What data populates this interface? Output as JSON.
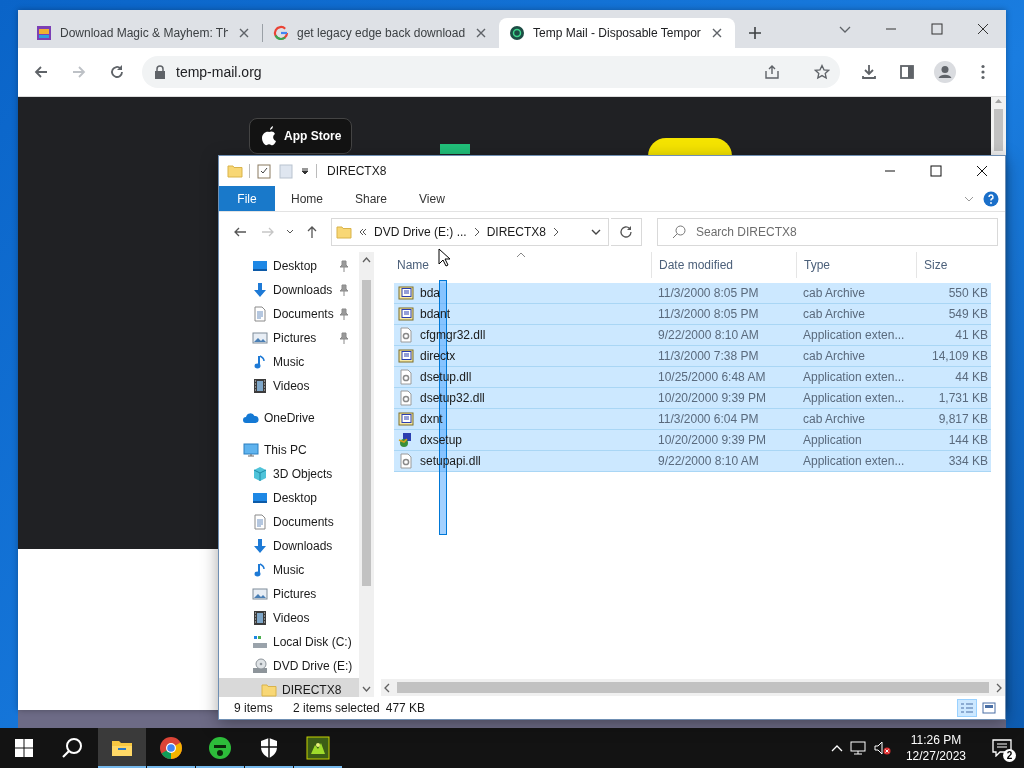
{
  "browser": {
    "tabs": [
      {
        "title": "Download Magic & Mayhem: Th",
        "kind": "game",
        "selected": false
      },
      {
        "title": "get legacy edge back download",
        "kind": "google",
        "selected": false
      },
      {
        "title": "Temp Mail - Disposable Tempor",
        "kind": "tempmail",
        "selected": true
      }
    ],
    "forward_disabled": true,
    "address": "temp-mail.org",
    "page": {
      "app_store_button": "App Store"
    }
  },
  "explorer": {
    "title": "DIRECTX8",
    "ribbon_tabs": [
      {
        "label": "File",
        "selected": true
      },
      {
        "label": "Home",
        "selected": false
      },
      {
        "label": "Share",
        "selected": false
      },
      {
        "label": "View",
        "selected": false
      }
    ],
    "forward_disabled": true,
    "breadcrumb": [
      "DVD Drive (E:) ...",
      "DIRECTX8"
    ],
    "search": {
      "placeholder": "Search DIRECTX8"
    },
    "quick_access": [
      {
        "label": "Desktop",
        "kind": "desktop",
        "pinned": true,
        "selected": false
      },
      {
        "label": "Downloads",
        "kind": "downloads",
        "pinned": true,
        "selected": false
      },
      {
        "label": "Documents",
        "kind": "documents",
        "pinned": true,
        "selected": false
      },
      {
        "label": "Pictures",
        "kind": "pictures",
        "pinned": true,
        "selected": false
      },
      {
        "label": "Music",
        "kind": "music",
        "pinned": false,
        "selected": false
      },
      {
        "label": "Videos",
        "kind": "videos",
        "pinned": false,
        "selected": false
      }
    ],
    "locations": [
      {
        "label": "OneDrive",
        "kind": "onedrive",
        "selected": false
      },
      {
        "label": "This PC",
        "kind": "pc",
        "selected": false,
        "children": [
          {
            "label": "3D Objects",
            "kind": "objects",
            "selected": false
          },
          {
            "label": "Desktop",
            "kind": "desktop",
            "selected": false
          },
          {
            "label": "Documents",
            "kind": "documents",
            "selected": false
          },
          {
            "label": "Downloads",
            "kind": "downloads",
            "selected": false
          },
          {
            "label": "Music",
            "kind": "music",
            "selected": false
          },
          {
            "label": "Pictures",
            "kind": "pictures",
            "selected": false
          },
          {
            "label": "Videos",
            "kind": "videos",
            "selected": false
          },
          {
            "label": "Local Disk (C:)",
            "kind": "disk",
            "selected": false
          },
          {
            "label": "DVD Drive (E:)",
            "kind": "dvd",
            "selected": false,
            "children": [
              {
                "label": "DIRECTX8",
                "kind": "folder",
                "selected": true
              }
            ]
          }
        ]
      }
    ],
    "columns": [
      "Name",
      "Date modified",
      "Type",
      "Size"
    ],
    "rows": [
      {
        "name": "bda",
        "date": "11/3/2000 8:05 PM",
        "type": "cab Archive",
        "size": "550 KB",
        "kind": "cab",
        "selected": true
      },
      {
        "name": "bdant",
        "date": "11/3/2000 8:05 PM",
        "type": "cab Archive",
        "size": "549 KB",
        "kind": "cab",
        "selected": true
      },
      {
        "name": "cfgmgr32.dll",
        "date": "9/22/2000 8:10 AM",
        "type": "Application exten...",
        "size": "41 KB",
        "kind": "dll",
        "selected": true
      },
      {
        "name": "directx",
        "date": "11/3/2000 7:38 PM",
        "type": "cab Archive",
        "size": "14,109 KB",
        "kind": "cab",
        "selected": true
      },
      {
        "name": "dsetup.dll",
        "date": "10/25/2000 6:48 AM",
        "type": "Application exten...",
        "size": "44 KB",
        "kind": "dll",
        "selected": true
      },
      {
        "name": "dsetup32.dll",
        "date": "10/20/2000 9:39 PM",
        "type": "Application exten...",
        "size": "1,731 KB",
        "kind": "dll",
        "selected": true
      },
      {
        "name": "dxnt",
        "date": "11/3/2000 6:04 PM",
        "type": "cab Archive",
        "size": "9,817 KB",
        "kind": "cab",
        "selected": true
      },
      {
        "name": "dxsetup",
        "date": "10/20/2000 9:39 PM",
        "type": "Application",
        "size": "144 KB",
        "kind": "app",
        "selected": true
      },
      {
        "name": "setupapi.dll",
        "date": "9/22/2000 8:10 AM",
        "type": "Application exten...",
        "size": "334 KB",
        "kind": "dll",
        "selected": true
      }
    ],
    "status": {
      "items": "9 items",
      "selection": "2 items selected",
      "size": "477 KB"
    },
    "view_buttons": [
      {
        "kind": "details",
        "selected": true
      },
      {
        "kind": "large",
        "selected": false
      }
    ]
  },
  "taskbar": {
    "apps": [
      {
        "kind": "explorer",
        "running": true,
        "selected": true
      },
      {
        "kind": "chrome",
        "running": true,
        "selected": false
      },
      {
        "kind": "mask",
        "running": true,
        "selected": false
      },
      {
        "kind": "shield",
        "running": true,
        "selected": false
      },
      {
        "kind": "game",
        "running": true,
        "selected": false
      }
    ],
    "time": "11:26 PM",
    "date": "12/27/2023",
    "notification_count": "2"
  }
}
